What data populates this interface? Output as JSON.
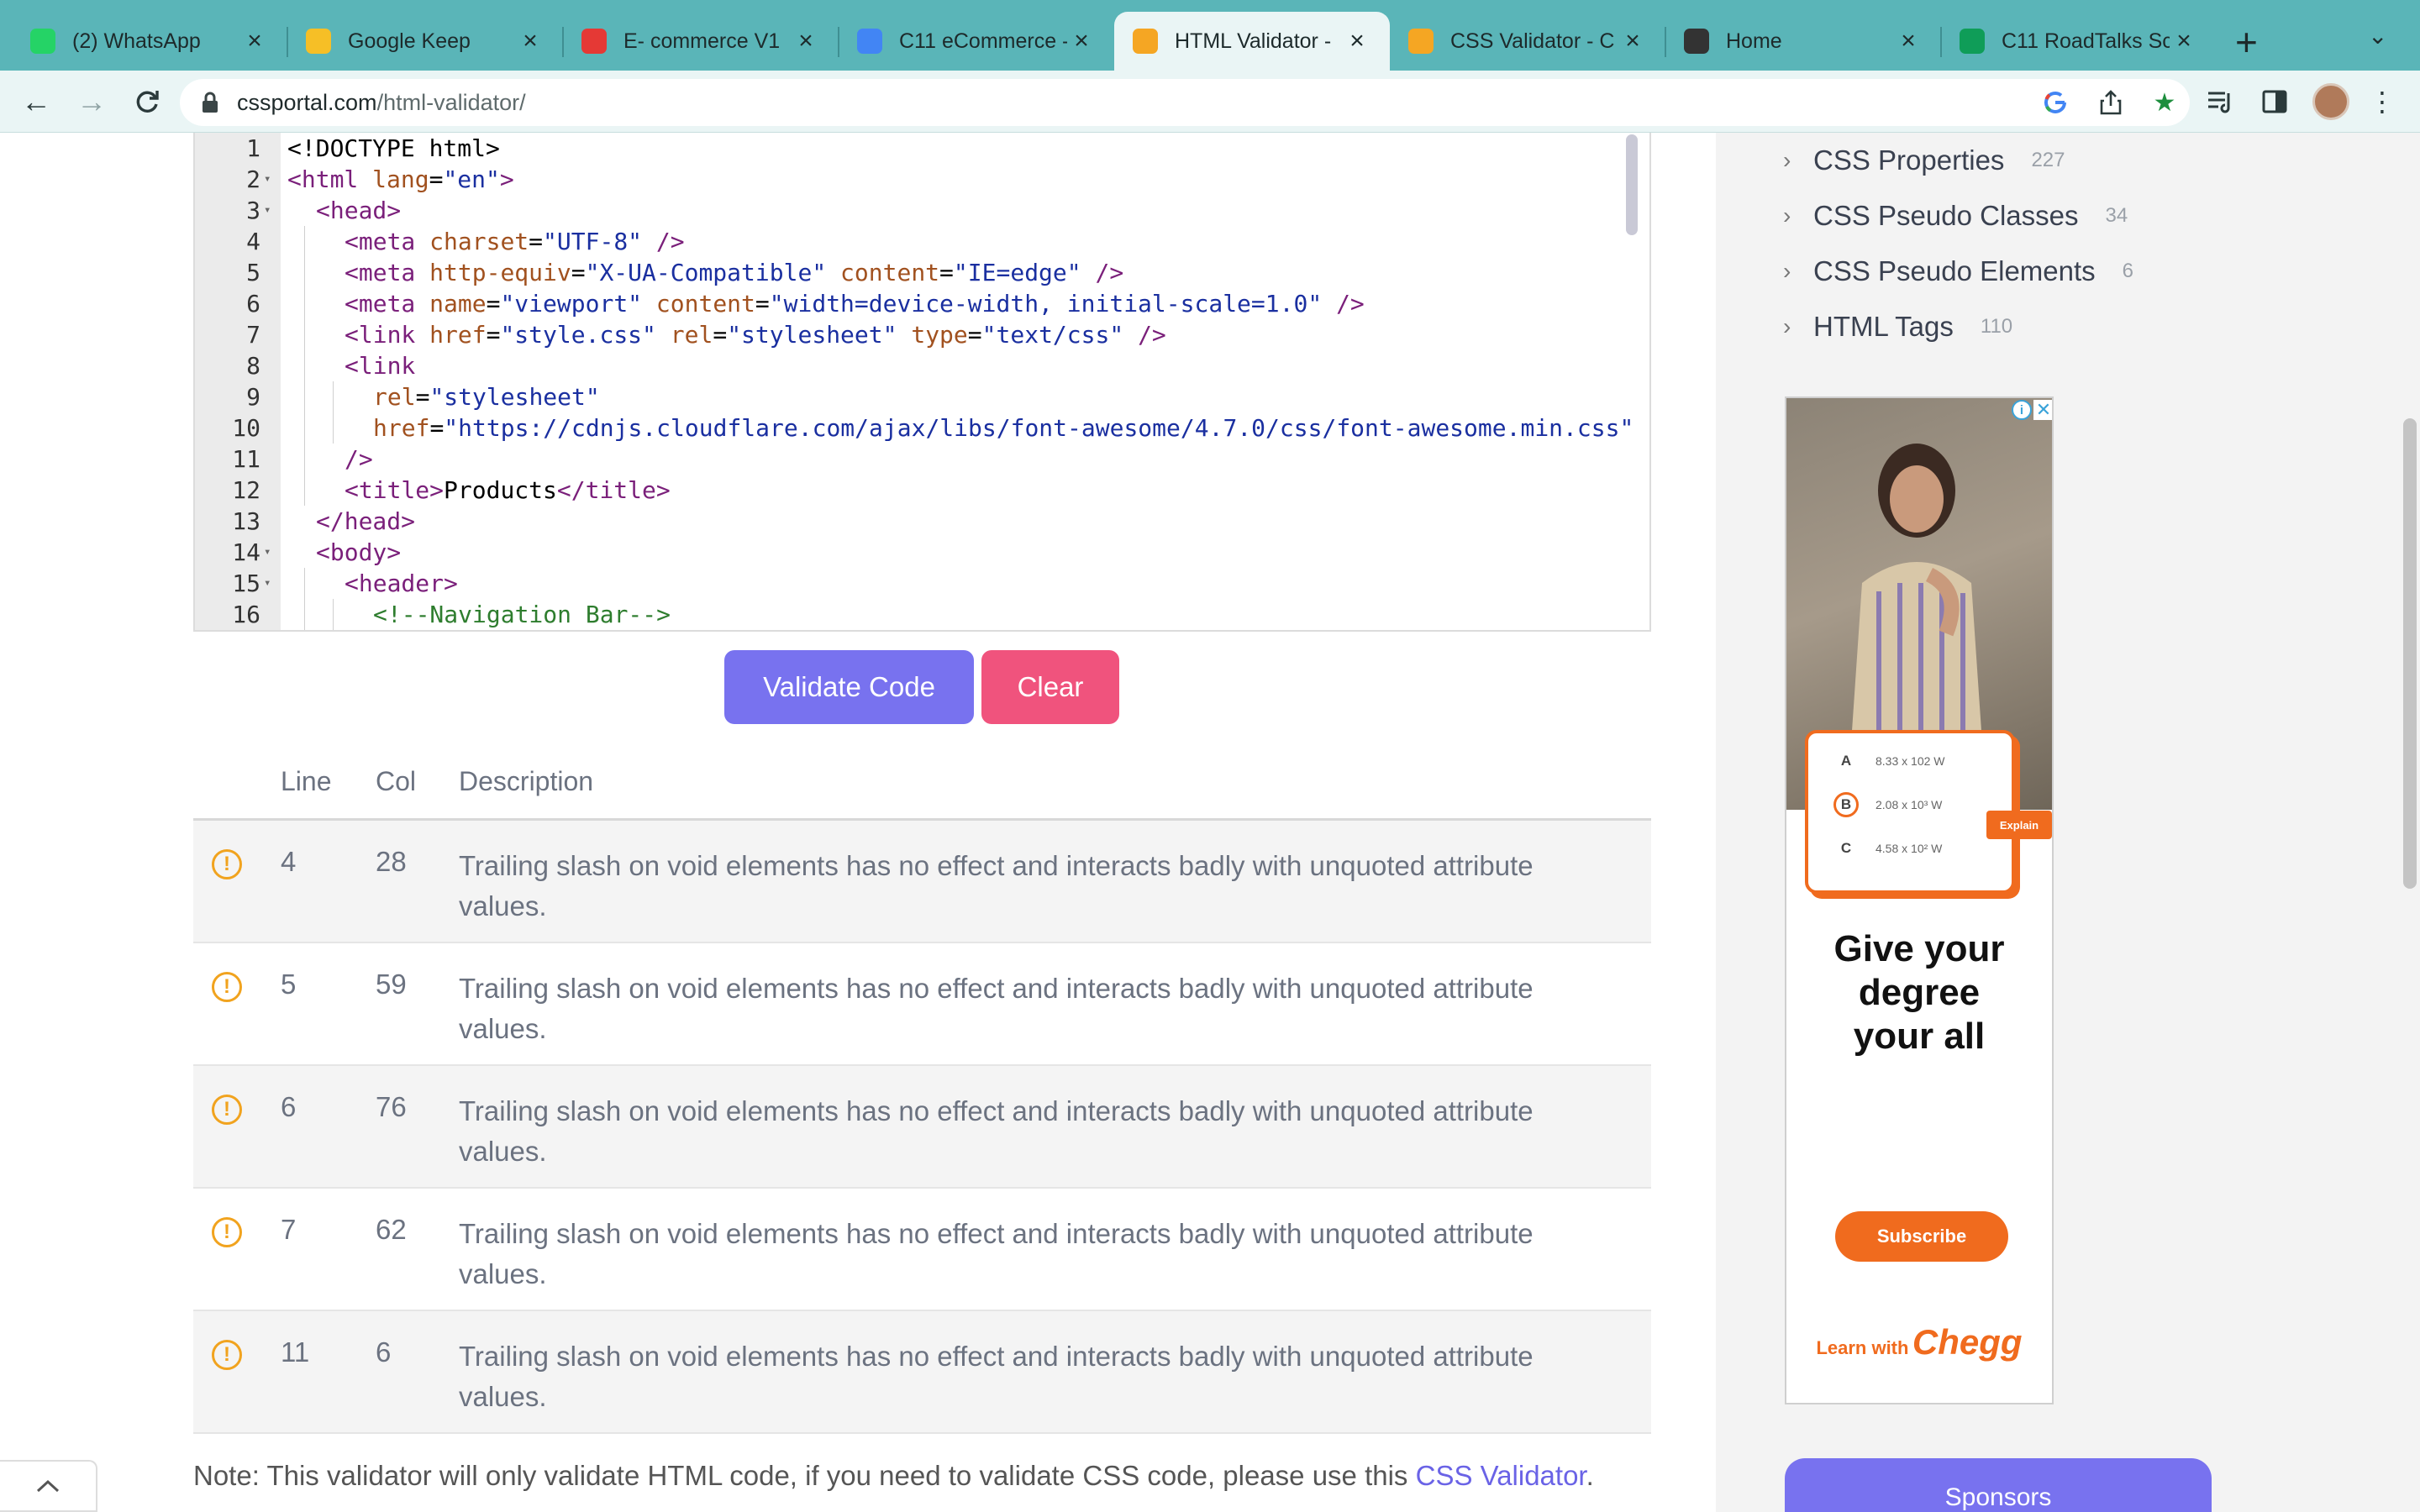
{
  "browser": {
    "tabs": [
      {
        "title": "(2) WhatsApp",
        "icon": "whatsapp-icon",
        "color": "#25d366"
      },
      {
        "title": "Google Keep",
        "icon": "keep-icon",
        "color": "#f6bf26"
      },
      {
        "title": "E- commerce V1",
        "icon": "ecommerce-icon",
        "color": "#e53935"
      },
      {
        "title": "C11 eCommerce -",
        "icon": "docs-icon",
        "color": "#4285f4"
      },
      {
        "title": "HTML Validator -",
        "icon": "cssportal-icon",
        "color": "#f5a623"
      },
      {
        "title": "CSS Validator - C",
        "icon": "cssportal-icon",
        "color": "#f5a623"
      },
      {
        "title": "Home",
        "icon": "globe-icon",
        "color": "#333333"
      },
      {
        "title": "C11 RoadTalks Sc",
        "icon": "sheets-icon",
        "color": "#0f9d58"
      }
    ],
    "new_tab": "+",
    "url_host": "cssportal.com",
    "url_path": "/html-validator/"
  },
  "editor": {
    "lines": [
      {
        "n": "1",
        "fold": "",
        "indent": 0,
        "tokens": [
          [
            "tx",
            "<!DOCTYPE html>"
          ]
        ]
      },
      {
        "n": "2",
        "fold": "▾",
        "indent": 0,
        "tokens": [
          [
            "tg",
            "<html "
          ],
          [
            "at",
            "lang"
          ],
          [
            "tx",
            "="
          ],
          [
            "vl",
            "\"en\""
          ],
          [
            "tg",
            ">"
          ]
        ]
      },
      {
        "n": "3",
        "fold": "▾",
        "indent": 1,
        "tokens": [
          [
            "tg",
            "<head>"
          ]
        ]
      },
      {
        "n": "4",
        "fold": "",
        "indent": 2,
        "tokens": [
          [
            "tg",
            "<meta "
          ],
          [
            "at",
            "charset"
          ],
          [
            "tx",
            "="
          ],
          [
            "vl",
            "\"UTF-8\""
          ],
          [
            "tg",
            " />"
          ]
        ]
      },
      {
        "n": "5",
        "fold": "",
        "indent": 2,
        "tokens": [
          [
            "tg",
            "<meta "
          ],
          [
            "at",
            "http-equiv"
          ],
          [
            "tx",
            "="
          ],
          [
            "vl",
            "\"X-UA-Compatible\""
          ],
          [
            "tx",
            " "
          ],
          [
            "at",
            "content"
          ],
          [
            "tx",
            "="
          ],
          [
            "vl",
            "\"IE=edge\""
          ],
          [
            "tg",
            " />"
          ]
        ]
      },
      {
        "n": "6",
        "fold": "",
        "indent": 2,
        "tokens": [
          [
            "tg",
            "<meta "
          ],
          [
            "at",
            "name"
          ],
          [
            "tx",
            "="
          ],
          [
            "vl",
            "\"viewport\""
          ],
          [
            "tx",
            " "
          ],
          [
            "at",
            "content"
          ],
          [
            "tx",
            "="
          ],
          [
            "vl",
            "\"width=device-width, initial-scale=1.0\""
          ],
          [
            "tg",
            " />"
          ]
        ]
      },
      {
        "n": "7",
        "fold": "",
        "indent": 2,
        "tokens": [
          [
            "tg",
            "<link "
          ],
          [
            "at",
            "href"
          ],
          [
            "tx",
            "="
          ],
          [
            "vl",
            "\"style.css\""
          ],
          [
            "tx",
            " "
          ],
          [
            "at",
            "rel"
          ],
          [
            "tx",
            "="
          ],
          [
            "vl",
            "\"stylesheet\""
          ],
          [
            "tx",
            " "
          ],
          [
            "at",
            "type"
          ],
          [
            "tx",
            "="
          ],
          [
            "vl",
            "\"text/css\""
          ],
          [
            "tg",
            " />"
          ]
        ]
      },
      {
        "n": "8",
        "fold": "",
        "indent": 2,
        "tokens": [
          [
            "tg",
            "<link"
          ]
        ]
      },
      {
        "n": "9",
        "fold": "",
        "indent": 3,
        "tokens": [
          [
            "at",
            "rel"
          ],
          [
            "tx",
            "="
          ],
          [
            "vl",
            "\"stylesheet\""
          ]
        ]
      },
      {
        "n": "10",
        "fold": "",
        "indent": 3,
        "tokens": [
          [
            "at",
            "href"
          ],
          [
            "tx",
            "="
          ],
          [
            "vl",
            "\"https://cdnjs.cloudflare.com/ajax/libs/font-awesome/4.7.0/css/font-awesome.min.css\""
          ]
        ]
      },
      {
        "n": "11",
        "fold": "",
        "indent": 2,
        "tokens": [
          [
            "tg",
            "/>"
          ]
        ]
      },
      {
        "n": "12",
        "fold": "",
        "indent": 2,
        "tokens": [
          [
            "tg",
            "<title>"
          ],
          [
            "tx",
            "Products"
          ],
          [
            "tg",
            "</title>"
          ]
        ]
      },
      {
        "n": "13",
        "fold": "",
        "indent": 1,
        "tokens": [
          [
            "tg",
            "</head>"
          ]
        ]
      },
      {
        "n": "14",
        "fold": "▾",
        "indent": 1,
        "tokens": [
          [
            "tg",
            "<body>"
          ]
        ]
      },
      {
        "n": "15",
        "fold": "▾",
        "indent": 2,
        "tokens": [
          [
            "tg",
            "<header>"
          ]
        ]
      },
      {
        "n": "16",
        "fold": "",
        "indent": 3,
        "tokens": [
          [
            "cm",
            "<!--Navigation Bar-->"
          ]
        ]
      }
    ]
  },
  "actions": {
    "validate_label": "Validate Code",
    "clear_label": "Clear"
  },
  "results": {
    "headers": {
      "line": "Line",
      "col": "Col",
      "desc": "Description"
    },
    "rows": [
      {
        "line": "4",
        "col": "28",
        "desc": "Trailing slash on void elements has no effect and interacts badly with unquoted attribute values."
      },
      {
        "line": "5",
        "col": "59",
        "desc": "Trailing slash on void elements has no effect and interacts badly with unquoted attribute values."
      },
      {
        "line": "6",
        "col": "76",
        "desc": "Trailing slash on void elements has no effect and interacts badly with unquoted attribute values."
      },
      {
        "line": "7",
        "col": "62",
        "desc": "Trailing slash on void elements has no effect and interacts badly with unquoted attribute values."
      },
      {
        "line": "11",
        "col": "6",
        "desc": "Trailing slash on void elements has no effect and interacts badly with unquoted attribute values."
      }
    ]
  },
  "note": {
    "text": "Note: This validator will only validate HTML code, if you need to validate CSS code, please use this ",
    "link": "CSS Validator",
    "suffix": "."
  },
  "sidebar": {
    "items": [
      {
        "label": "CSS Properties",
        "count": "227"
      },
      {
        "label": "CSS Pseudo Classes",
        "count": "34"
      },
      {
        "label": "CSS Pseudo Elements",
        "count": "6"
      },
      {
        "label": "HTML Tags",
        "count": "110"
      }
    ],
    "sponsors_label": "Sponsors"
  },
  "ad": {
    "options": [
      {
        "letter": "A",
        "value": "8.33 x 102 W"
      },
      {
        "letter": "B",
        "value": "2.08 x 10³ W"
      },
      {
        "letter": "C",
        "value": "4.58 x 10² W"
      }
    ],
    "explain": "Explain",
    "headline": [
      "Give your",
      "degree",
      "your all"
    ],
    "subscribe": "Subscribe",
    "learn": "Learn with",
    "brand": "Chegg",
    "accent": "#f06b1e"
  },
  "colors": {
    "validate": "#7872ef",
    "clear": "#f0537d",
    "warning": "#f1a31e",
    "chrome": "#5ab5b8"
  }
}
